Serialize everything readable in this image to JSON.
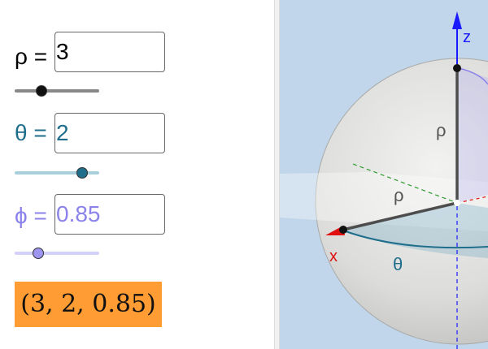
{
  "controls": {
    "rho": {
      "label": "ρ =",
      "value": "3",
      "slider_fraction": 0.32,
      "color": "#000000",
      "track_color": "#888888",
      "knob_color": "#111111"
    },
    "theta": {
      "label": "θ =",
      "value": "2",
      "slider_fraction": 0.8,
      "color": "#1f6e8c",
      "track_color": "#a9cfdd",
      "knob_color": "#1f6e8c"
    },
    "phi": {
      "label": "ϕ =",
      "value": "0.85",
      "slider_fraction": 0.28,
      "color": "#8b82ea",
      "track_color": "#d4d1f8",
      "knob_color": "#9d96f0"
    }
  },
  "result": {
    "text": "(3, 2, 0.85)",
    "background": "#ff9c33"
  },
  "graphics": {
    "axis_z_label": "z",
    "axis_x_label": "x",
    "rho_label_upper": "ρ",
    "rho_label_lower": "ρ",
    "theta_label": "θ",
    "colors": {
      "z_axis": "#1a1aff",
      "x_axis": "#e01010",
      "y_axis": "#2e9a2e",
      "theta_arc": "#1f6e8c",
      "phi_arc": "#8b82ea",
      "background": "#c1d6ea"
    }
  }
}
